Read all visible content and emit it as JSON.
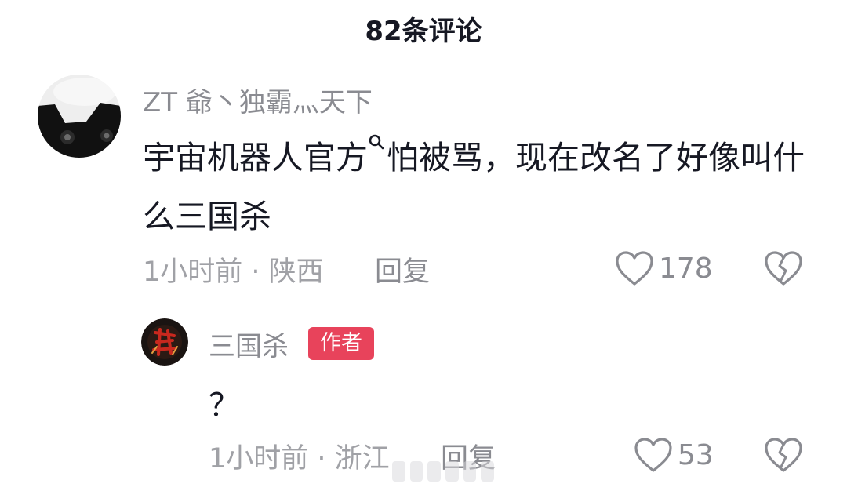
{
  "header": {
    "title": "82条评论"
  },
  "comments": [
    {
      "username": "ZT 爺丶独霸灬天下",
      "text_before_icon": "宇宙机器人官方",
      "text_after_icon": "怕被骂，现在改名了好像叫什么三国杀",
      "time_location": "1小时前 · 陕西",
      "reply_label": "回复",
      "like_count": "178",
      "avatar_icon": "black-cat-avatar"
    },
    {
      "username": "三国杀",
      "badge": "作者",
      "text": "？",
      "time_location": "1小时前 · 浙江",
      "reply_label": "回复",
      "like_count": "53",
      "avatar_icon": "sanguosha-logo-avatar"
    }
  ],
  "colors": {
    "primary_text": "#161823",
    "secondary_text": "#8a8b91",
    "author_badge": "#e8435b"
  }
}
